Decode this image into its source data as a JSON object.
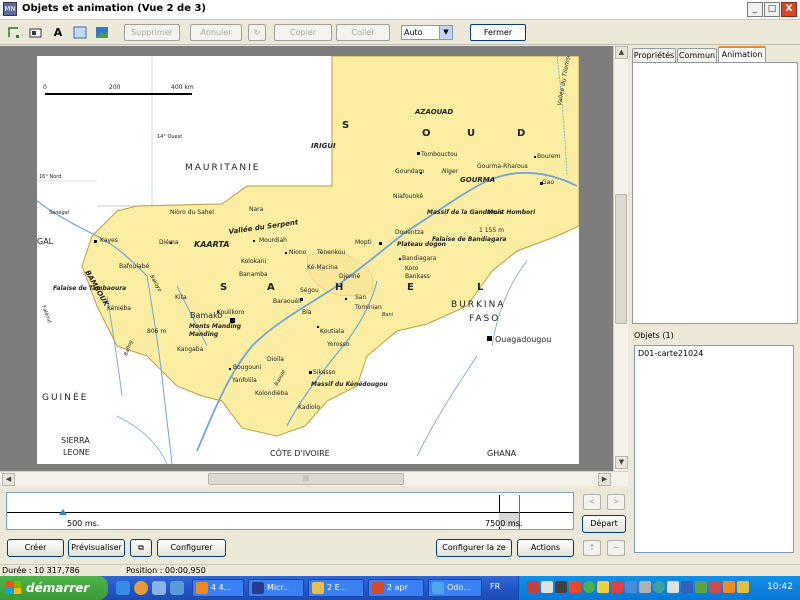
{
  "window": {
    "title": "Objets et animation  (Vue 2 de 3)",
    "app_icon": "MN",
    "min": "_",
    "max": "□",
    "close": "X"
  },
  "toolbar": {
    "icons": [
      "select-icon",
      "image-icon",
      "text-icon",
      "rectangle-icon",
      "picture-icon"
    ],
    "text_icon_glyph": "A",
    "delete_label": "Supprimer",
    "undo_label": "Annuler",
    "redo_label": "↻",
    "cut_label": "Copier",
    "paste_label": "Coller",
    "zoom_value": "Auto",
    "close_label": "Fermer"
  },
  "map": {
    "scale": [
      "0",
      "200",
      "400 km"
    ],
    "labels": {
      "irigui": "IRIGUI",
      "azaouad": "AZAOUAD",
      "soudan": [
        "S",
        "O",
        "U",
        "D"
      ],
      "mauritanie": "MAURITANIE",
      "tombouctou": "Tombouctou",
      "goundam": "Goundam",
      "gourma_rharous": "Gourma-Rharous",
      "bourem": "Bourem",
      "gourma": "GOURMA",
      "gao": "Gao",
      "niger": "Niger",
      "niafounke": "Niafounké",
      "vallee_tilemsi": "Vallée du Tilemsi",
      "vallee_serpent": "Vallée du Serpent",
      "nioro": "Nioro du Sahel",
      "nara": "Nara",
      "kayes": "Kayes",
      "diema": "Diéma",
      "kaarta": "KAARTA",
      "mourdiah": "Mourdiah",
      "niono": "Niono",
      "tenenkou": "Ténenkou",
      "mopti": "Mopti",
      "massif_gandamia": "Massif de la Gandamia",
      "douentza": "Douentza",
      "hombori": "Mont Hombori",
      "hombori_alt": "1 155 m",
      "plateau_dogon": "Plateau dogon",
      "falaise_bandiagara": "Falaise de Bandiagara",
      "bandiagara": "Bandiagara",
      "koro": "Koro",
      "bankass": "Bankass",
      "bafoulabe": "Bafoulabé",
      "kolokani": "Kolokani",
      "banamba": "Banamba",
      "ke_macina": "Ké-Macina",
      "djenne": "Djenné",
      "sahel": [
        "S",
        "A",
        "H",
        "E",
        "L"
      ],
      "bambouk": "BAMBOUK",
      "falaise_tambaoura": "Falaise de Tambaoura",
      "kita": "Kita",
      "kenieba": "Kéniéba",
      "koulikoro": "Koulikoro",
      "baraouli": "Baraouéli",
      "segou": "Ségou",
      "san": "San",
      "tominian": "Tominian",
      "bla": "Bla",
      "koutiala": "Koutiala",
      "yorosso": "Yorosso",
      "bamako": "Bamako",
      "monts_manding": "Monts Manding",
      "alt_806": "806 m",
      "kangaba": "Kangaba",
      "bougouni": "Bougouni",
      "yanfolila": "Yanfolila",
      "kolondieba": "Kolondiéba",
      "dioila": "Dioïla",
      "sikasso": "Sikasso",
      "massif_kenedougou": "Massif du Kénédougou",
      "kadiolo": "Kadiolo",
      "burkina": "BURKINA",
      "faso": "FASO",
      "ouagadougou": "Ouagadougou",
      "guinee": "GUINÉE",
      "sierra": "SIERRA",
      "leone": "LEONE",
      "cote_ivoire": "CÔTE D'IVOIRE",
      "ghana": "GHANA",
      "senegal_frag": "GAL",
      "long_14": "14° Ouest",
      "lat_16": "16° Nord",
      "bani": "Bani",
      "senegal_river": "Sénégal",
      "falem": "Falémé",
      "bafing": "Bafing",
      "bakoye": "Bakoye",
      "baoule": "Baoulé"
    }
  },
  "hscroll_mark": "|||",
  "panel": {
    "tabs": [
      "Propriétés",
      "Commun",
      "Animation"
    ],
    "selected_tab": 2,
    "objects_label": "Objets (1)",
    "objects": [
      "D01-carte21024"
    ]
  },
  "timeline": {
    "start_label": "500 ms.",
    "end_label": "7500 ms."
  },
  "buttons": {
    "prev": "<",
    "next": ">",
    "depart": "Départ",
    "creer": "Créer",
    "previsualiser": "Prévisualiser",
    "copy": "⧉",
    "configurer": "Configurer",
    "configurer_lente": "Configurer la ze",
    "actions": "Actions",
    "up": "↑",
    "down": "−"
  },
  "status": {
    "duree": "Durée : 10 317,786",
    "position": "Position : 00:00,950"
  },
  "taskbar": {
    "start": "démarrer",
    "tasks": [
      "4 4...",
      "Micr...",
      "2 E...",
      "2 apr",
      "Odo...",
      "FR"
    ],
    "clock": "10:42"
  },
  "colors": {
    "mali_fill": "#fbeea2",
    "water": "#6fa6d6",
    "accent_tab": "#e68b2c",
    "taskbar": "#2457c8",
    "start": "#3a9a35"
  }
}
